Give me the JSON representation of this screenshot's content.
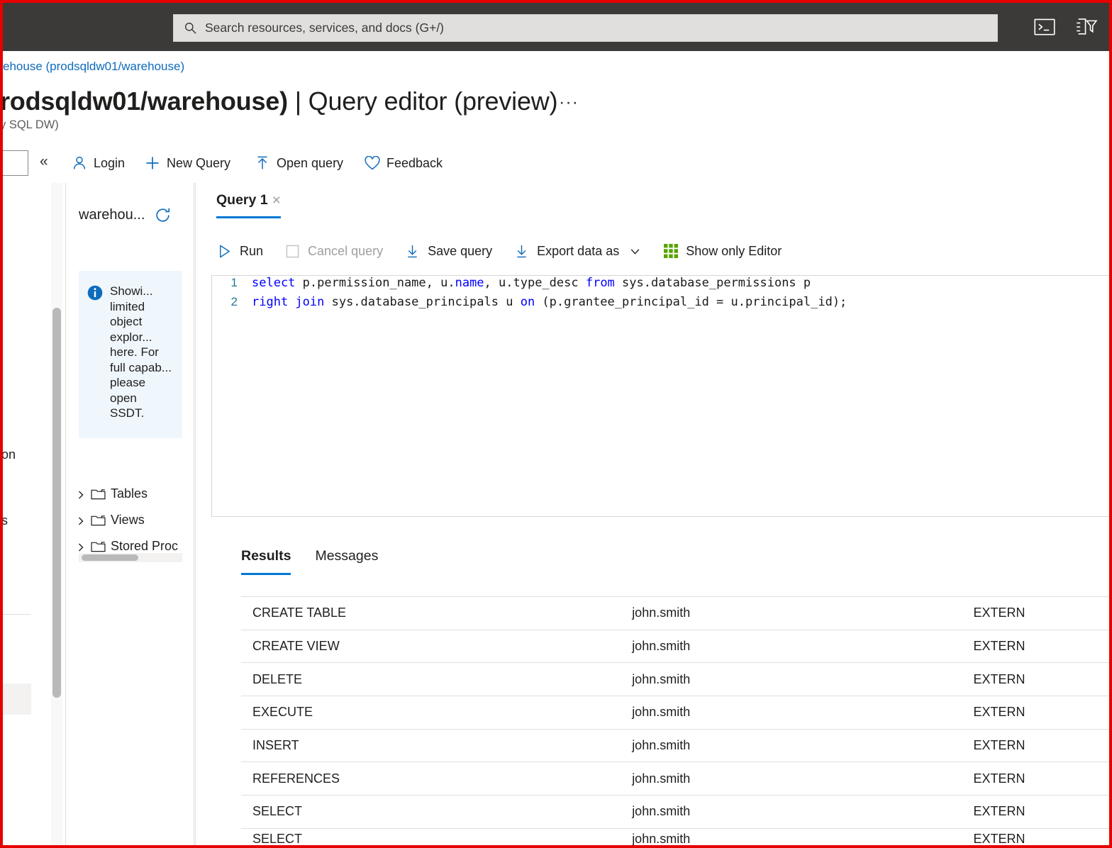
{
  "topbar": {
    "search": {
      "placeholder": "Search resources, services, and docs (G+/)",
      "icon": "search-icon"
    },
    "icons": [
      {
        "name": "cloud-shell-icon",
        "label": "Cloud Shell"
      },
      {
        "name": "directories-subscriptions-icon",
        "label": "Directories + subscriptions"
      }
    ]
  },
  "header": {
    "breadcrumb": "ehouse (prodsqldw01/warehouse)",
    "title_bold": "rodsqldw01/warehouse)",
    "title_rest": " | Query editor (preview)",
    "more_menu": "···",
    "subtitle": "y SQL DW)"
  },
  "commandbar": {
    "collapse": "«",
    "items": [
      {
        "label": "Login",
        "icon": "person-icon"
      },
      {
        "label": "New Query",
        "icon": "plus-icon"
      },
      {
        "label": "Open query",
        "icon": "upload-icon"
      },
      {
        "label": "Feedback",
        "icon": "heart-icon"
      }
    ]
  },
  "object_explorer": {
    "db_name": "warehou...",
    "refresh_icon": "refresh-icon",
    "info": {
      "icon": "info-icon",
      "text": "Showi... limited object explor... here. For full capab... please open SSDT."
    },
    "tree": [
      {
        "label": "Tables",
        "icon": "folder-icon",
        "chevron": "chevron-right-icon"
      },
      {
        "label": "Views",
        "icon": "folder-icon",
        "chevron": "chevron-right-icon"
      },
      {
        "label": "Stored Proc",
        "icon": "folder-icon",
        "chevron": "chevron-right-icon"
      }
    ],
    "collapse_arrow": "‹"
  },
  "editor": {
    "tab": {
      "label": "Query 1",
      "close": "×"
    },
    "toolbar": [
      {
        "label": "Run",
        "icon": "play-icon",
        "disabled": false
      },
      {
        "label": "Cancel query",
        "icon": "stop-square-icon",
        "disabled": true
      },
      {
        "label": "Save query",
        "icon": "download-icon",
        "disabled": false
      },
      {
        "label": "Export data as",
        "icon": "download-icon",
        "disabled": false,
        "chevron": "chevron-down-icon"
      },
      {
        "label": "Show only Editor",
        "icon": "grid-icon",
        "disabled": false
      }
    ],
    "sql": [
      {
        "num": "1",
        "tokens": [
          {
            "t": "select",
            "kw": true
          },
          {
            "t": " p.permission_name, u.",
            "kw": false
          },
          {
            "t": "name",
            "kw": true
          },
          {
            "t": ", u.type_desc ",
            "kw": false
          },
          {
            "t": "from",
            "kw": true
          },
          {
            "t": " sys.database_permissions p",
            "kw": false
          }
        ]
      },
      {
        "num": "2",
        "tokens": [
          {
            "t": "right join",
            "kw": true
          },
          {
            "t": " sys.database_principals u ",
            "kw": false
          },
          {
            "t": "on",
            "kw": true
          },
          {
            "t": " (p.grantee_principal_id = u.principal_id);",
            "kw": false
          }
        ]
      }
    ]
  },
  "results": {
    "tabs": [
      {
        "label": "Results",
        "active": true
      },
      {
        "label": "Messages",
        "active": false
      }
    ],
    "rows": [
      {
        "permission_name": "CREATE TABLE",
        "name": "john.smith",
        "type_desc": "EXTERN"
      },
      {
        "permission_name": "CREATE VIEW",
        "name": "john.smith",
        "type_desc": "EXTERN"
      },
      {
        "permission_name": "DELETE",
        "name": "john.smith",
        "type_desc": "EXTERN"
      },
      {
        "permission_name": "EXECUTE",
        "name": "john.smith",
        "type_desc": "EXTERN"
      },
      {
        "permission_name": "INSERT",
        "name": "john.smith",
        "type_desc": "EXTERN"
      },
      {
        "permission_name": "REFERENCES",
        "name": "john.smith",
        "type_desc": "EXTERN"
      },
      {
        "permission_name": "SELECT",
        "name": "john.smith",
        "type_desc": "EXTERN"
      },
      {
        "permission_name": "SELECT",
        "name": "john.smith",
        "type_desc": "EXTERN"
      }
    ]
  },
  "left_nav_fragments": [
    {
      "text": "on"
    },
    {
      "text": "s"
    }
  ],
  "colors": {
    "azure_blue": "#0f6cbd",
    "accent": "#0078d4",
    "topbar_bg": "#3b3a39",
    "info_bg": "#eff6fc",
    "keyword": "#0000ff",
    "grid_green": "#57a300",
    "highlight_border": "#e60000"
  }
}
